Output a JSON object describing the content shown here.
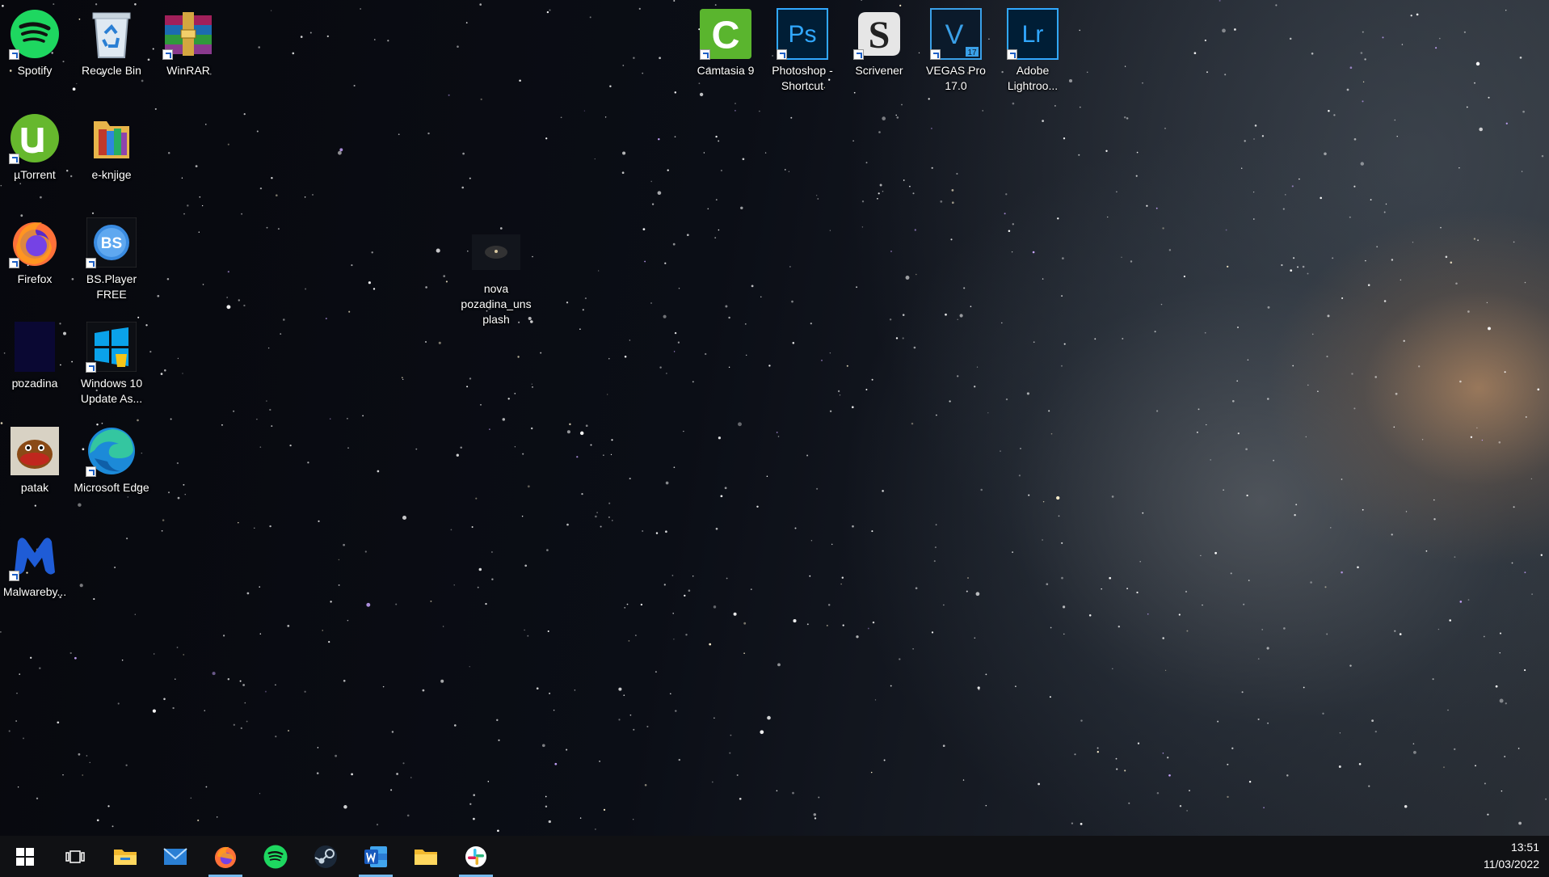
{
  "desktop_icons": [
    {
      "id": "spotify",
      "label": "Spotify",
      "icon": "spotify-icon",
      "shortcut": true
    },
    {
      "id": "recycle-bin",
      "label": "Recycle Bin",
      "icon": "recycle-bin-icon",
      "shortcut": false
    },
    {
      "id": "winrar",
      "label": "WinRAR",
      "icon": "winrar-icon",
      "shortcut": true
    },
    {
      "id": "utorrent",
      "label": "µTorrent",
      "icon": "utorrent-icon",
      "shortcut": true
    },
    {
      "id": "e-knjige",
      "label": "e-knjige",
      "icon": "folder-icon",
      "shortcut": false
    },
    {
      "id": "firefox",
      "label": "Firefox",
      "icon": "firefox-icon",
      "shortcut": true
    },
    {
      "id": "bsplayer",
      "label": "BS.Player FREE",
      "icon": "bsplayer-icon",
      "shortcut": true
    },
    {
      "id": "pozadina",
      "label": "pozadina",
      "icon": "image-file-icon",
      "shortcut": false
    },
    {
      "id": "win10-update",
      "label": "Windows 10 Update As...",
      "icon": "windows-update-icon",
      "shortcut": true
    },
    {
      "id": "patak",
      "label": "patak",
      "icon": "image-file-icon",
      "shortcut": false
    },
    {
      "id": "edge",
      "label": "Microsoft Edge",
      "icon": "edge-icon",
      "shortcut": true
    },
    {
      "id": "malwarebytes",
      "label": "Malwareby...",
      "icon": "malwarebytes-icon",
      "shortcut": true
    },
    {
      "id": "nova-pozadina",
      "label": "nova pozadina_unsplash",
      "icon": "image-file-icon",
      "shortcut": false
    },
    {
      "id": "camtasia",
      "label": "Camtasia 9",
      "icon": "camtasia-icon",
      "shortcut": true
    },
    {
      "id": "photoshop",
      "label": "Photoshop - Shortcut",
      "icon": "photoshop-icon",
      "shortcut": true
    },
    {
      "id": "scrivener",
      "label": "Scrivener",
      "icon": "scrivener-icon",
      "shortcut": true
    },
    {
      "id": "vegas",
      "label": "VEGAS Pro 17.0",
      "icon": "vegas-pro-icon",
      "shortcut": true
    },
    {
      "id": "lightroom",
      "label": "Adobe Lightroo...",
      "icon": "lightroom-icon",
      "shortcut": true
    }
  ],
  "glyph_text": {
    "photoshop": "Ps",
    "lightroom": "Lr",
    "vegas": "V",
    "vegas_badge": "17",
    "bsplayer": "BS",
    "camtasia": "C",
    "scrivener": "S"
  },
  "taskbar": {
    "items": [
      {
        "id": "start",
        "icon": "windows-start-icon",
        "state": "none"
      },
      {
        "id": "task-view",
        "icon": "task-view-icon",
        "state": "none"
      },
      {
        "id": "file-explorer",
        "icon": "file-explorer-icon",
        "state": "none"
      },
      {
        "id": "mail",
        "icon": "mail-icon",
        "state": "none"
      },
      {
        "id": "firefox",
        "icon": "firefox-icon",
        "state": "open"
      },
      {
        "id": "spotify",
        "icon": "spotify-icon",
        "state": "none"
      },
      {
        "id": "steam",
        "icon": "steam-icon",
        "state": "none"
      },
      {
        "id": "word",
        "icon": "word-icon",
        "state": "open"
      },
      {
        "id": "folder",
        "icon": "folder-icon",
        "state": "none"
      },
      {
        "id": "slack",
        "icon": "slack-icon",
        "state": "open"
      }
    ],
    "clock_time": "13:51",
    "clock_date": "11/03/2022"
  },
  "colors": {
    "taskbar_bg": "#101114",
    "spotify_green": "#1ed760",
    "photoshop_blue": "#31a8ff",
    "photoshop_bg": "#001e36",
    "lightroom_blue": "#31a8ff",
    "camtasia_green": "#5ab52e",
    "accent": "#76b9ed"
  }
}
